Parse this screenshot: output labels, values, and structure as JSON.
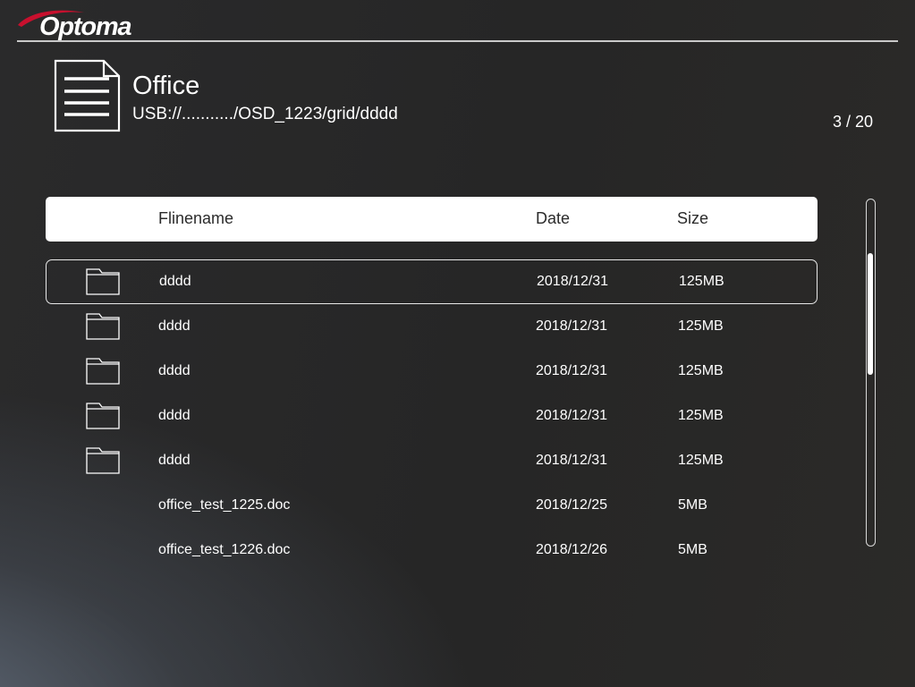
{
  "brand": {
    "logo_text": "Optoma",
    "accent_color": "#c8102e"
  },
  "header": {
    "title": "Office",
    "path": "USB://.........../OSD_1223/grid/dddd",
    "page_indicator": "3 / 20",
    "icon": "document-icon"
  },
  "table": {
    "columns": [
      "Flinename",
      "Date",
      "Size"
    ],
    "selected_index": 0,
    "rows": [
      {
        "name": "dddd",
        "date": "2018/12/31",
        "size": "125MB",
        "type": "folder"
      },
      {
        "name": "dddd",
        "date": "2018/12/31",
        "size": "125MB",
        "type": "folder"
      },
      {
        "name": "dddd",
        "date": "2018/12/31",
        "size": "125MB",
        "type": "folder"
      },
      {
        "name": "dddd",
        "date": "2018/12/31",
        "size": "125MB",
        "type": "folder"
      },
      {
        "name": "dddd",
        "date": "2018/12/31",
        "size": "125MB",
        "type": "folder"
      },
      {
        "name": "office_test_1225.doc",
        "date": "2018/12/25",
        "size": "5MB",
        "type": "file"
      },
      {
        "name": "office_test_1226.doc",
        "date": "2018/12/26",
        "size": "5MB",
        "type": "file"
      }
    ]
  }
}
